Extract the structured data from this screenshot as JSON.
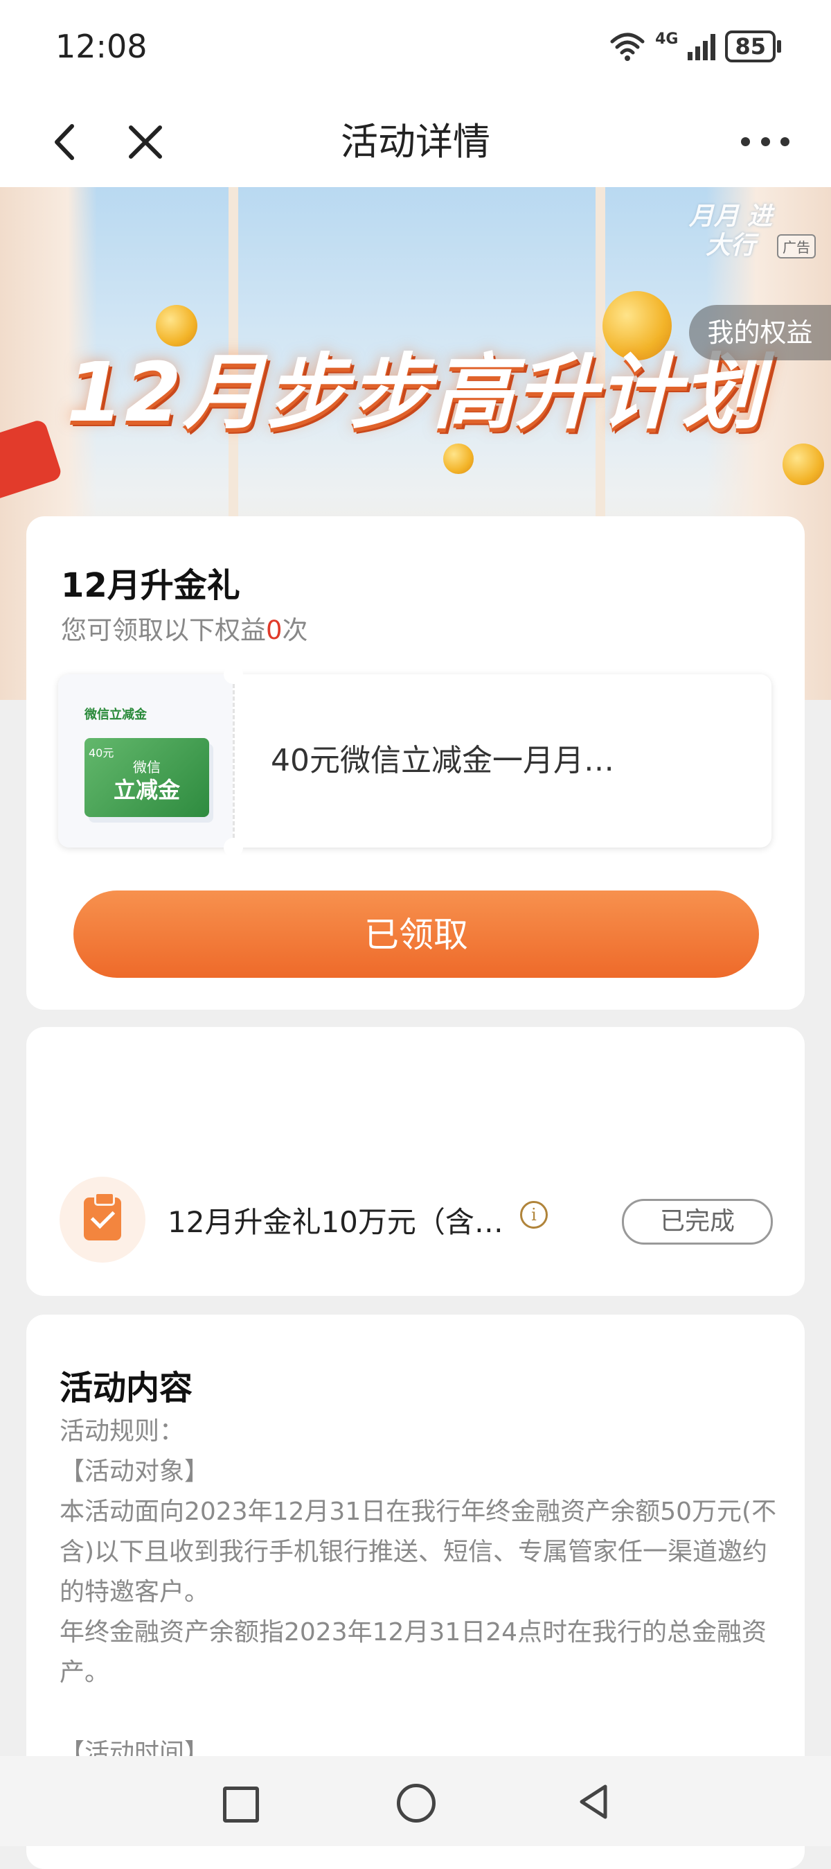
{
  "status": {
    "time": "12:08",
    "network": "4G",
    "battery": "85"
  },
  "nav": {
    "title": "活动详情"
  },
  "banner": {
    "title": "12月步步高升计划",
    "logo_text": "月月 进大行",
    "ad_tag": "广告",
    "my_rights": "我的权益"
  },
  "gift_card": {
    "title": "12月升金礼",
    "subtitle_prefix": "您可领取以下权益",
    "subtitle_count": "0",
    "subtitle_suffix": "次",
    "coupon": {
      "small_label": "微信立减金",
      "card_amount": "40元",
      "card_line1": "微信",
      "card_line2": "立减金",
      "text": "40元微信立减金一月月…"
    },
    "button_label": "已领取"
  },
  "task_card": {
    "task_text": "12月升金礼10万元（含…",
    "info_symbol": "i",
    "status_label": "已完成"
  },
  "content_card": {
    "title": "活动内容",
    "lines": [
      "活动规则：",
      "【活动对象】",
      "本活动面向2023年12月31日在我行年终金融资产余额50万元(不含)以下且收到我行手机银行推送、短信、专属管家任一渠道邀约的特邀客户。",
      "年终金融资产余额指2023年12月31日24点时在我行的总金融资产。",
      "",
      "【活动时间】"
    ]
  },
  "colors": {
    "accent": "#ee6a2a",
    "highlight_red": "#e03a2a",
    "coupon_green": "#2e8b3f"
  }
}
